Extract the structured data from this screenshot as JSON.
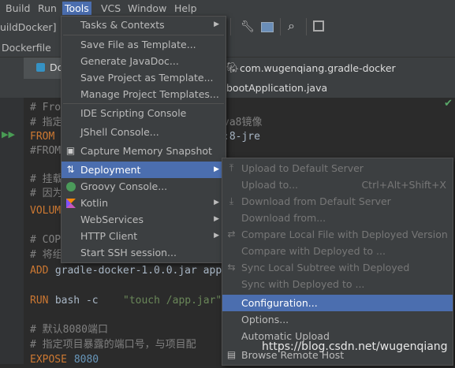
{
  "menubar": {
    "items": [
      {
        "label": "Build"
      },
      {
        "label": "Run"
      },
      {
        "label": "Tools"
      },
      {
        "label": "VCS"
      },
      {
        "label": "Window"
      },
      {
        "label": "Help"
      }
    ]
  },
  "project_tab": "uildDocker]",
  "breadcrumb_file": "Dockerfile",
  "breadcrumb_project": "com.wugenqiang.gradle-docker",
  "editor_tab_left": "Do",
  "editor_tab_right": "bootApplication.java",
  "code": {
    "l1": "# Fro",
    "l2a": "# 指定",
    "l2b": "va8镜像",
    "l3a": "FROM",
    "l3b": ":8-jre",
    "l4": "#FROM",
    "l5": "# 挂载",
    "l6": "# 因为",
    "l7": "VOLUM",
    "l8": "# COP",
    "l9": "# 将组",
    "l10a": "ADD",
    "l10b": " gradle-docker-1.0.0.jar app",
    "l11a": "RUN",
    "l11b": " bash -c ",
    "l11c": "\"touch /app.jar\"",
    "l12": "# 默认8080端口",
    "l13": "# 指定项目暴露的端口号，与项目配",
    "l14a": "EXPOSE",
    "l14b": " 8080"
  },
  "tools_menu": {
    "items": [
      {
        "label": "Tasks & Contexts",
        "icon": "none",
        "submenu": true
      },
      {
        "label": "Save File as Template...",
        "icon": "none"
      },
      {
        "label": "Generate JavaDoc...",
        "icon": "none"
      },
      {
        "label": "Save Project as Template...",
        "icon": "none"
      },
      {
        "label": "Manage Project Templates...",
        "icon": "none"
      },
      {
        "label": "IDE Scripting Console",
        "icon": "none"
      },
      {
        "label": "JShell Console...",
        "icon": "none"
      },
      {
        "label": "Capture Memory Snapshot",
        "icon": "memory-snapshot-icon"
      },
      {
        "label": "Deployment",
        "icon": "deployment-icon",
        "submenu": true
      },
      {
        "label": "Groovy Console...",
        "icon": "groovy-icon"
      },
      {
        "label": "Kotlin",
        "icon": "kotlin-icon",
        "submenu": true
      },
      {
        "label": "WebServices",
        "icon": "none",
        "submenu": true
      },
      {
        "label": "HTTP Client",
        "icon": "none",
        "submenu": true
      },
      {
        "label": "Start SSH session...",
        "icon": "none"
      }
    ]
  },
  "deployment_menu": {
    "items": [
      {
        "label": "Upload to Default Server",
        "shortcut": ""
      },
      {
        "label": "Upload to...",
        "shortcut": "Ctrl+Alt+Shift+X"
      },
      {
        "label": "Download from Default Server",
        "shortcut": ""
      },
      {
        "label": "Download from...",
        "shortcut": ""
      },
      {
        "label": "Compare Local File with Deployed Version",
        "shortcut": ""
      },
      {
        "label": "Compare with Deployed to ...",
        "shortcut": ""
      },
      {
        "label": "Sync Local Subtree with Deployed",
        "shortcut": ""
      },
      {
        "label": "Sync with Deployed to ...",
        "shortcut": ""
      },
      {
        "label": "Configuration...",
        "shortcut": ""
      },
      {
        "label": "Options...",
        "shortcut": ""
      },
      {
        "label": "Automatic Upload",
        "shortcut": ""
      },
      {
        "label": "Browse Remote Host",
        "shortcut": ""
      }
    ]
  },
  "watermark": "https://blog.csdn.net/wugenqiang",
  "colors": {
    "accent": "#4b6eaf",
    "menu_bg": "#3c3f41",
    "editor_bg": "#2b2b2b"
  }
}
